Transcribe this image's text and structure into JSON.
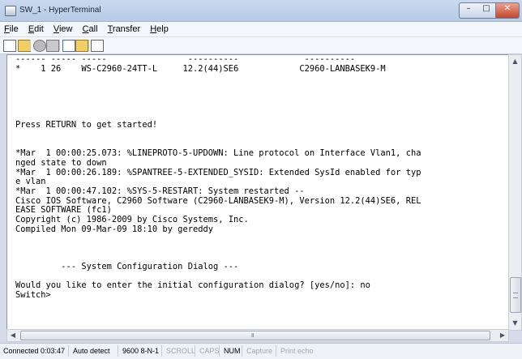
{
  "window": {
    "title": "SW_1 - HyperTerminal"
  },
  "menu": {
    "items": [
      "File",
      "Edit",
      "View",
      "Call",
      "Transfer",
      "Help"
    ]
  },
  "toolbar": {
    "icons": [
      "new-icon",
      "open-icon",
      "disconnect-icon",
      "call-icon",
      "send-icon",
      "receive-icon",
      "properties-icon"
    ]
  },
  "terminal": {
    "lines": [
      "------ ----- -----                ----------             ----------",
      "*    1 26    WS-C2960-24TT-L     12.2(44)SE6            C2960-LANBASEK9-M",
      "",
      "",
      "",
      "",
      "",
      "Press RETURN to get started!",
      "",
      "",
      "*Mar  1 00:00:25.073: %LINEPROTO-5-UPDOWN: Line protocol on Interface Vlan1, cha",
      "nged state to down",
      "*Mar  1 00:00:26.189: %SPANTREE-5-EXTENDED_SYSID: Extended SysId enabled for typ",
      "e vlan",
      "*Mar  1 00:00:47.102: %SYS-5-RESTART: System restarted --",
      "Cisco IOS Software, C2960 Software (C2960-LANBASEK9-M), Version 12.2(44)SE6, REL",
      "EASE SOFTWARE (fc1)",
      "Copyright (c) 1986-2009 by Cisco Systems, Inc.",
      "Compiled Mon 09-Mar-09 18:10 by gereddy",
      "",
      "",
      "",
      "         --- System Configuration Dialog ---",
      "",
      "Would you like to enter the initial configuration dialog? [yes/no]: no",
      "Switch>"
    ]
  },
  "status": {
    "connected": "Connected 0:03:47",
    "detect": "Auto detect",
    "settings": "9600 8-N-1",
    "scroll": "SCROLL",
    "caps": "CAPS",
    "num": "NUM",
    "capture": "Capture",
    "print_echo": "Print echo"
  },
  "scrollbars": {
    "vertical_position": 0.98
  }
}
